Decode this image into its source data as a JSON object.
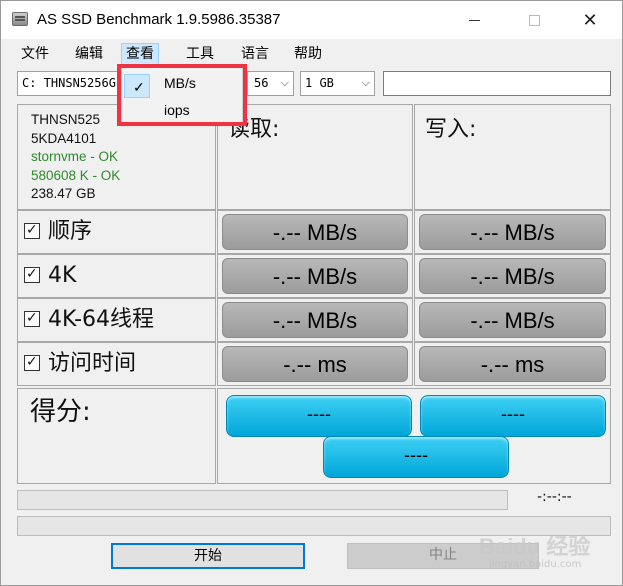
{
  "window": {
    "title": "AS SSD Benchmark 1.9.5986.35387"
  },
  "menu": {
    "file": "文件",
    "edit": "编辑",
    "view": "查看",
    "tools": "工具",
    "language": "语言",
    "help": "帮助"
  },
  "dropdown": {
    "items": [
      {
        "label": "MB/s",
        "checked": true
      },
      {
        "label": "iops",
        "checked": false
      }
    ]
  },
  "toolbar": {
    "drive_select": "C: THNSN5256G",
    "size_select_partial": "56",
    "size_select": "1 GB",
    "extra_input": ""
  },
  "drive_info": {
    "model": "THNSN525",
    "firmware": "5KDA4101",
    "driver": "stornvme - OK",
    "alignment": "580608 K - OK",
    "capacity": "238.47 GB"
  },
  "headers": {
    "read": "读取:",
    "write": "写入:"
  },
  "tests": [
    {
      "label": "顺序",
      "checked": true,
      "read": "-.-- MB/s",
      "write": "-.-- MB/s"
    },
    {
      "label": "4K",
      "checked": true,
      "read": "-.-- MB/s",
      "write": "-.-- MB/s"
    },
    {
      "label": "4K-64线程",
      "checked": true,
      "read": "-.-- MB/s",
      "write": "-.-- MB/s"
    },
    {
      "label": "访问时间",
      "checked": true,
      "read": "-.-- ms",
      "write": "-.-- ms"
    }
  ],
  "score": {
    "label": "得分:",
    "read": "----",
    "write": "----",
    "total": "----"
  },
  "timer": "-:--:--",
  "buttons": {
    "start": "开始",
    "stop": "中止"
  },
  "watermark": {
    "text": "Baidu 经验",
    "sub": "jingyan.baidu.com"
  },
  "colors": {
    "highlight": "#ee3344",
    "score_button": "#1ab8e6",
    "ok_text": "#2e8a2e",
    "focus": "#0078d7"
  }
}
